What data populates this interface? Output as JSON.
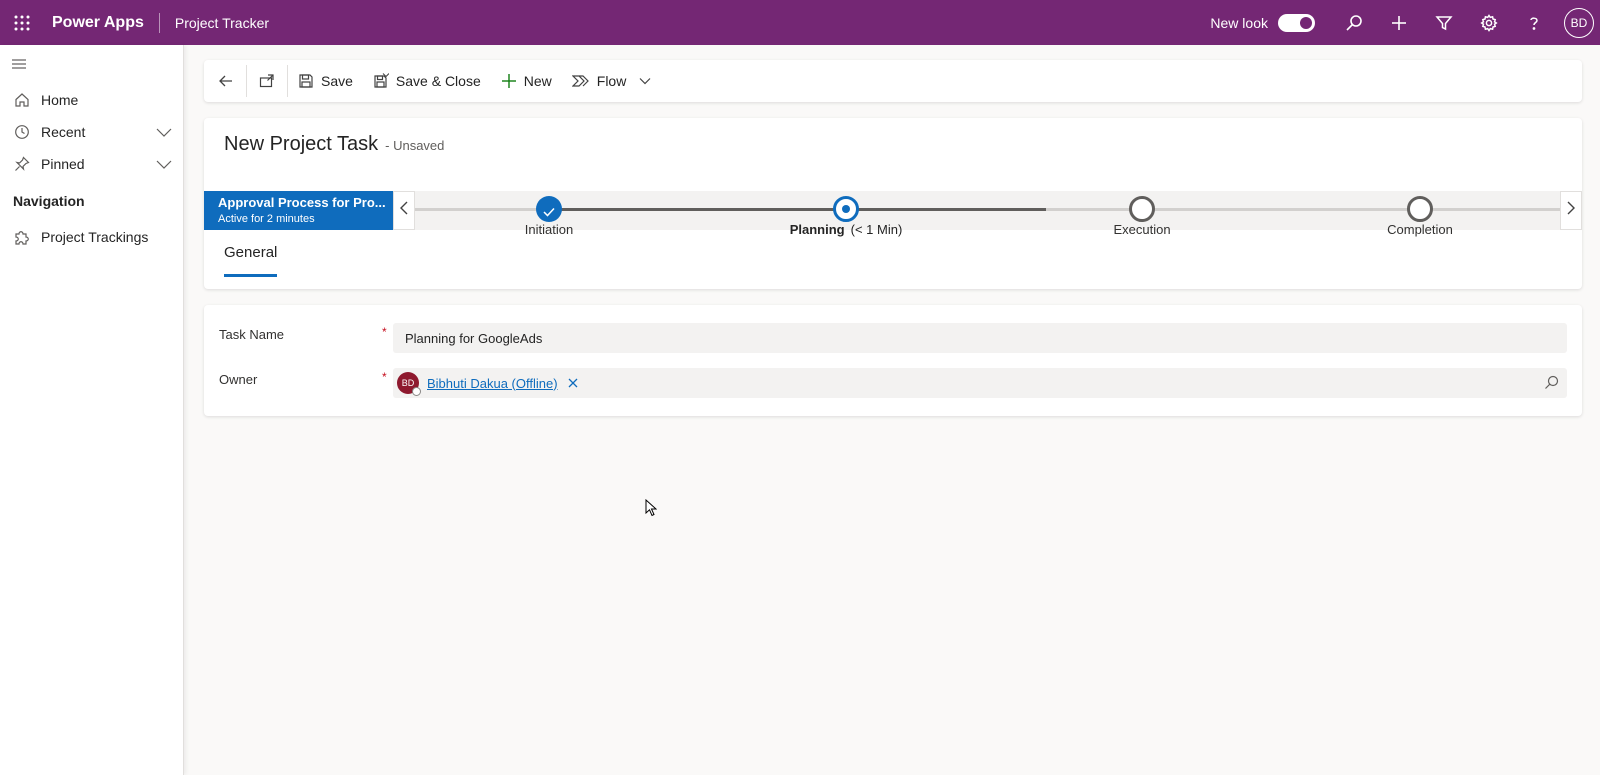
{
  "topbar": {
    "app_name": "Power Apps",
    "app_subtitle": "Project Tracker",
    "new_look_label": "New look",
    "new_look_enabled": true,
    "user_initials": "BD",
    "icons": [
      "waffle-icon",
      "search-icon",
      "plus-icon",
      "filter-icon",
      "gear-icon",
      "help-icon"
    ]
  },
  "sidebar": {
    "items": [
      {
        "label": "Home",
        "icon": "home-icon"
      },
      {
        "label": "Recent",
        "icon": "clock-icon",
        "expandable": true
      },
      {
        "label": "Pinned",
        "icon": "pin-icon",
        "expandable": true
      }
    ],
    "section_title": "Navigation",
    "nav_items": [
      {
        "label": "Project Trackings",
        "icon": "puzzle-icon"
      }
    ]
  },
  "commandbar": {
    "save_label": "Save",
    "save_close_label": "Save & Close",
    "new_label": "New",
    "flow_label": "Flow"
  },
  "header": {
    "title": "New Project Task",
    "status": "- Unsaved",
    "tab_label": "General"
  },
  "bpf": {
    "process_name": "Approval Process for Pro...",
    "process_duration": "Active for 2 minutes",
    "stages": [
      {
        "name": "Initiation",
        "state": "completed"
      },
      {
        "name": "Planning",
        "duration": "(< 1 Min)",
        "state": "active"
      },
      {
        "name": "Execution",
        "state": "pending"
      },
      {
        "name": "Completion",
        "state": "pending"
      }
    ]
  },
  "form": {
    "task_name_label": "Task Name",
    "task_name_value": "Planning for GoogleAds",
    "owner_label": "Owner",
    "owner_initials": "BD",
    "owner_value": "Bibhuti Dakua (Offline)",
    "required_marker": "*"
  },
  "colors": {
    "topbar": "#742774",
    "accent": "#0f6cbd",
    "owner_avatar": "#8e192e"
  }
}
